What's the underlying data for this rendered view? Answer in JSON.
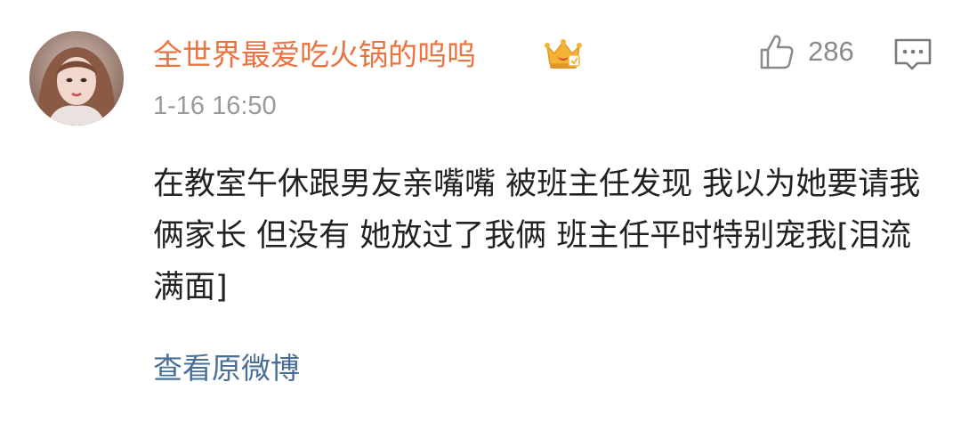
{
  "comment": {
    "avatar_icon": "user-avatar-photo",
    "username": "全世界最爱吃火锅的呜呜",
    "badge_icon": "vip-crown-icon",
    "badge_color": "#f5b335",
    "username_color": "#eb7340",
    "timestamp": "1-16 16:50",
    "like_icon": "thumbs-up-icon",
    "like_count": "286",
    "reply_icon": "comment-bubble-icon",
    "content": "在教室午休跟男友亲嘴嘴 被班主任发现 我以为她要请我俩家长 但没有 她放过了我俩 班主任平时特别宠我[泪流满面]",
    "view_original_label": "查看原微博",
    "link_color": "#4a6f96"
  }
}
